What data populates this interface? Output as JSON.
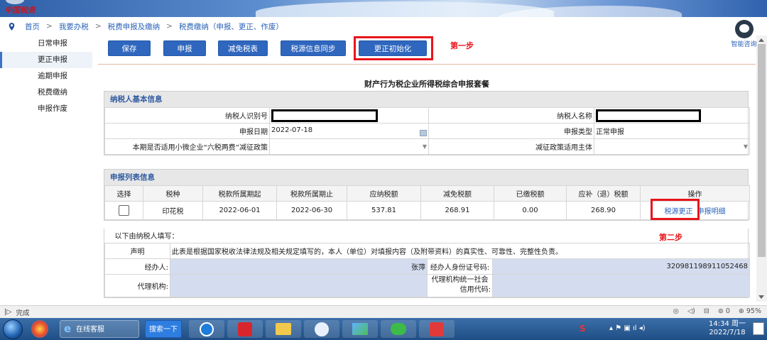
{
  "brand": {
    "logo_text": "中国税务"
  },
  "breadcrumb": [
    "首页",
    "我要办税",
    "税费申报及缴纳",
    "税费缴纳（申报、更正、作废）"
  ],
  "breadcrumb_sep": ">",
  "assistant": {
    "label": "智能咨询"
  },
  "sidebar": {
    "items": [
      {
        "label": "日常申报"
      },
      {
        "label": "更正申报"
      },
      {
        "label": "逾期申报"
      },
      {
        "label": "税费缴纳"
      },
      {
        "label": "申报作废"
      }
    ]
  },
  "toolbar": {
    "save": "保存",
    "declare": "申报",
    "exemption": "减免税表",
    "sync": "税源信息同步",
    "correct_init": "更正初始化",
    "step1": "第一步"
  },
  "form": {
    "title": "财产行为税企业所得税综合申报套餐",
    "basic": {
      "heading": "纳税人基本信息",
      "taxpayer_id_label": "纳税人识别号",
      "taxpayer_name_label": "纳税人名称",
      "declare_date_label": "申报日期",
      "declare_date": "2022-07-18",
      "declare_type_label": "申报类型",
      "declare_type": "正常申报",
      "policy_label": "本期是否适用小微企业“六税两费”减征政策",
      "policy_subject_label": "减征政策适用主体"
    },
    "list": {
      "heading": "申报列表信息",
      "columns": [
        "选择",
        "税种",
        "税款所属期起",
        "税款所属期止",
        "应纳税额",
        "减免税额",
        "已缴税额",
        "应补（退）税额",
        "操作"
      ],
      "rows": [
        {
          "tax": "印花税",
          "start": "2022-06-01",
          "end": "2022-06-30",
          "payable": "537.81",
          "reduction": "268.91",
          "paid": "0.00",
          "due": "268.90",
          "action1": "税源更正",
          "action2": "申报明细"
        }
      ],
      "step2": "第二步"
    },
    "declaration": {
      "intro": "以下由纳税人填写：",
      "statement_label": "声明",
      "statement": "此表是根据国家税收法律法规及相关规定填写的，本人（单位）对填报内容（及附带资料）的真实性、可靠性、完整性负责。",
      "agent_label": "经办人:",
      "agent_name": "张萍",
      "agent_id_label": "经办人身份证号码:",
      "agent_id": "320981198911052468",
      "agency_label": "代理机构:",
      "agency_credit_label_1": "代理机构统一社会",
      "agency_credit_label_2": "信用代码:"
    }
  },
  "statusbar": {
    "left": "完成",
    "zoom": "95%",
    "zero": "0"
  },
  "taskbar": {
    "ie_label": "在线客服",
    "search_label": "搜索一下",
    "time": "14:34 周一",
    "date": "2022/7/18"
  }
}
